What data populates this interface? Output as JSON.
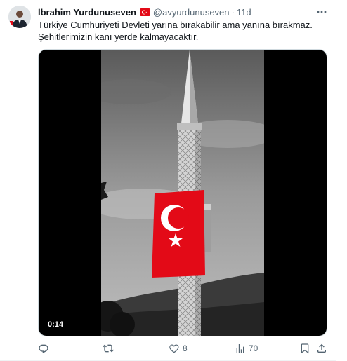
{
  "tweet": {
    "author_name": "İbrahim Yurdunuseven",
    "handle": "@avyurdunuseven",
    "separator": "·",
    "time": "11d",
    "text_lines": [
      "Türkiye Cumhuriyeti Devleti yarına bırakabilir ama yanına bırakmaz.",
      "Şehitlerimizin kanı yerde kalmayacaktır."
    ],
    "video_duration": "0:14"
  },
  "actions": {
    "reply_count": "",
    "retweet_count": "",
    "like_count": "8",
    "views_count": "70"
  },
  "icons": {
    "avatar": "avatar",
    "verified_flag": "turkey-flag-icon",
    "more": "more-icon",
    "reply": "reply-icon",
    "retweet": "retweet-icon",
    "like": "heart-icon",
    "views": "views-icon",
    "bookmark": "bookmark-icon",
    "share": "share-icon"
  },
  "colors": {
    "text_primary": "#0f1419",
    "text_secondary": "#536471",
    "flag_red": "#e30a17",
    "border": "#cfd9de"
  }
}
